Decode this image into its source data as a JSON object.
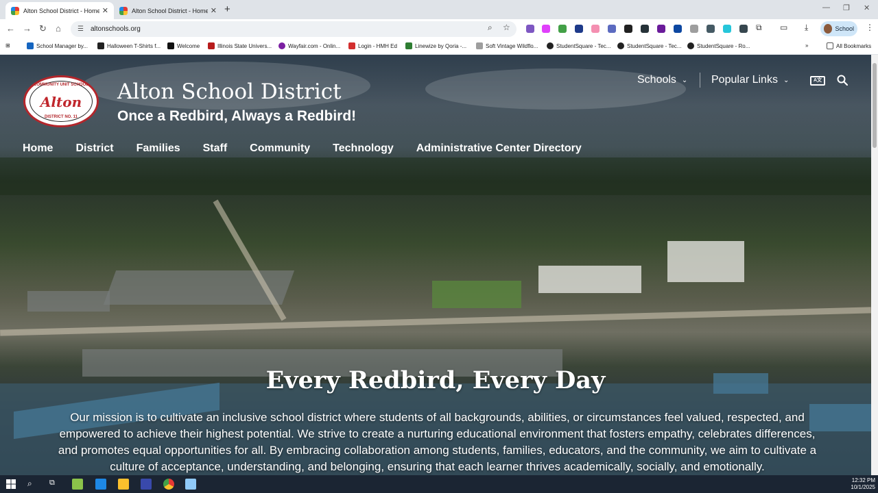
{
  "browser": {
    "tabs": [
      {
        "title": "Alton School District - Home",
        "active": true
      },
      {
        "title": "Alton School District - Home",
        "active": false
      }
    ],
    "new_tab": "+",
    "address": "altonschools.org",
    "profile_label": "School",
    "bookmarks": [
      "School Manager by...",
      "Halloween T-Shirts f...",
      "Welcome",
      "Illinois State Univers...",
      "Wayfair.com - Onlin...",
      "Login - HMH Ed",
      "Linewize by Qoria -...",
      "Soft Vintage Wildflo...",
      "StudentSquare - Tec...",
      "StudentSquare - Tec...",
      "StudentSquare - Ro..."
    ],
    "all_bookmarks": "All Bookmarks"
  },
  "site": {
    "logo": {
      "top": "COMMUNITY UNIT SCHOOL",
      "word": "Alton",
      "bottom": "DISTRICT NO. 11"
    },
    "title": "Alton School District",
    "tagline": "Once a Redbird, Always a Redbird!",
    "util_nav": [
      {
        "label": "Schools"
      },
      {
        "label": "Popular Links"
      }
    ],
    "main_nav": [
      "Home",
      "District",
      "Families",
      "Staff",
      "Community",
      "Technology",
      "Administrative Center Directory"
    ],
    "hero_heading": "Every Redbird, Every Day",
    "mission": "Our mission is to cultivate an inclusive school district where students of all backgrounds, abilities, or circumstances feel valued, respected, and empowered to achieve their highest potential. We strive to create a nurturing educational environment that fosters empathy, celebrates differences, and promotes equal opportunities for all. By embracing collaboration among students, families, educators, and the community, we aim to cultivate a culture of acceptance, understanding, and belonging, ensuring that each learner thrives academically, socially, and emotionally."
  },
  "taskbar": {
    "time": "12:32 PM",
    "date": "10/1/2025"
  },
  "colors": {
    "brand_red": "#b3262b",
    "profile_bg": "#cfe6f8",
    "taskbar": "#1b2533"
  }
}
